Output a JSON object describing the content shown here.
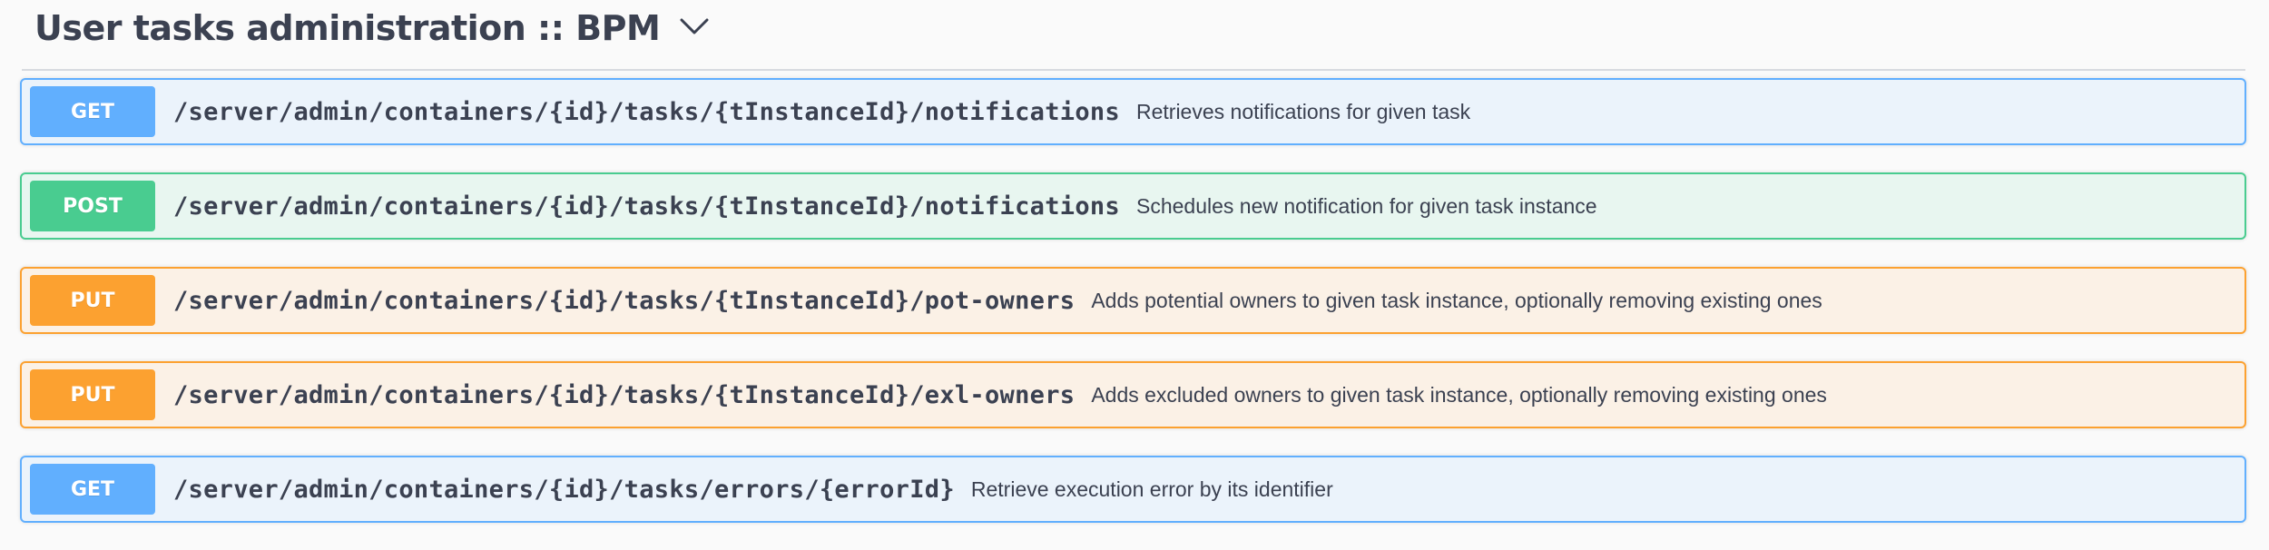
{
  "section": {
    "title": "User tasks administration :: BPM",
    "toggle_icon": "chevron-down-icon"
  },
  "operations": [
    {
      "method": "GET",
      "path": "/server/admin/containers/{id}/tasks/{tInstanceId}/notifications",
      "summary": "Retrieves notifications for given task"
    },
    {
      "method": "POST",
      "path": "/server/admin/containers/{id}/tasks/{tInstanceId}/notifications",
      "summary": "Schedules new notification for given task instance"
    },
    {
      "method": "PUT",
      "path": "/server/admin/containers/{id}/tasks/{tInstanceId}/pot-owners",
      "summary": "Adds potential owners to given task instance, optionally removing existing ones"
    },
    {
      "method": "PUT",
      "path": "/server/admin/containers/{id}/tasks/{tInstanceId}/exl-owners",
      "summary": "Adds excluded owners to given task instance, optionally removing existing ones"
    },
    {
      "method": "GET",
      "path": "/server/admin/containers/{id}/tasks/errors/{errorId}",
      "summary": "Retrieve execution error by its identifier"
    }
  ],
  "colors": {
    "get": "#61affe",
    "post": "#49cc90",
    "put": "#fca130",
    "text": "#3b4151"
  }
}
